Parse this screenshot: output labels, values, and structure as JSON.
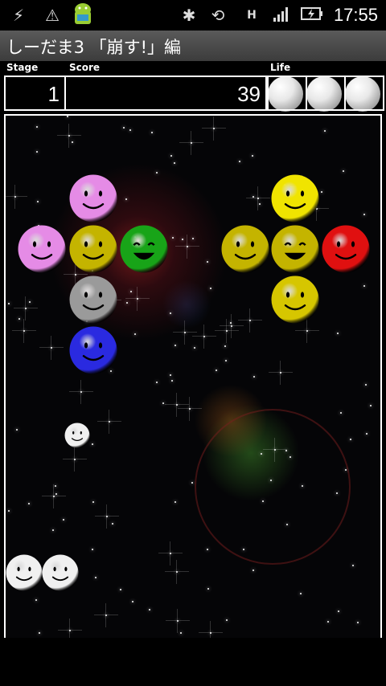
{
  "status_bar": {
    "time": "17:55",
    "icons": [
      "usb-debug-icon",
      "warning-icon",
      "android-icon",
      "bluetooth-icon",
      "rotate-icon",
      "data-hsdpa-icon",
      "signal-icon",
      "battery-charging-icon"
    ]
  },
  "app": {
    "title": "しーだま3 「崩す!」編"
  },
  "hud": {
    "stage_label": "Stage",
    "score_label": "Score",
    "life_label": "Life",
    "stage_value": "1",
    "score_value": "39",
    "lives": 3
  },
  "game": {
    "pieces": [
      {
        "color": "#e58be6",
        "face": "smile"
      },
      {
        "color": "#e58be6",
        "face": "smile"
      },
      {
        "color": "#c4b400",
        "face": "smile"
      },
      {
        "color": "#18a418",
        "face": "grin"
      },
      {
        "color": "#9a9a9a",
        "face": "smile"
      },
      {
        "color": "#2a2ae0",
        "face": "smile"
      },
      {
        "color": "#f0e400",
        "face": "smile"
      },
      {
        "color": "#c4b400",
        "face": "smile"
      },
      {
        "color": "#c4b400",
        "face": "grin"
      },
      {
        "color": "#e01010",
        "face": "smile"
      },
      {
        "color": "#d6c600",
        "face": "smile"
      },
      {
        "color": "#f0f0f0",
        "face": "smile"
      },
      {
        "color": "#f0f0f0",
        "face": "smile"
      },
      {
        "color": "#f0f0f0",
        "face": "smile"
      }
    ]
  }
}
